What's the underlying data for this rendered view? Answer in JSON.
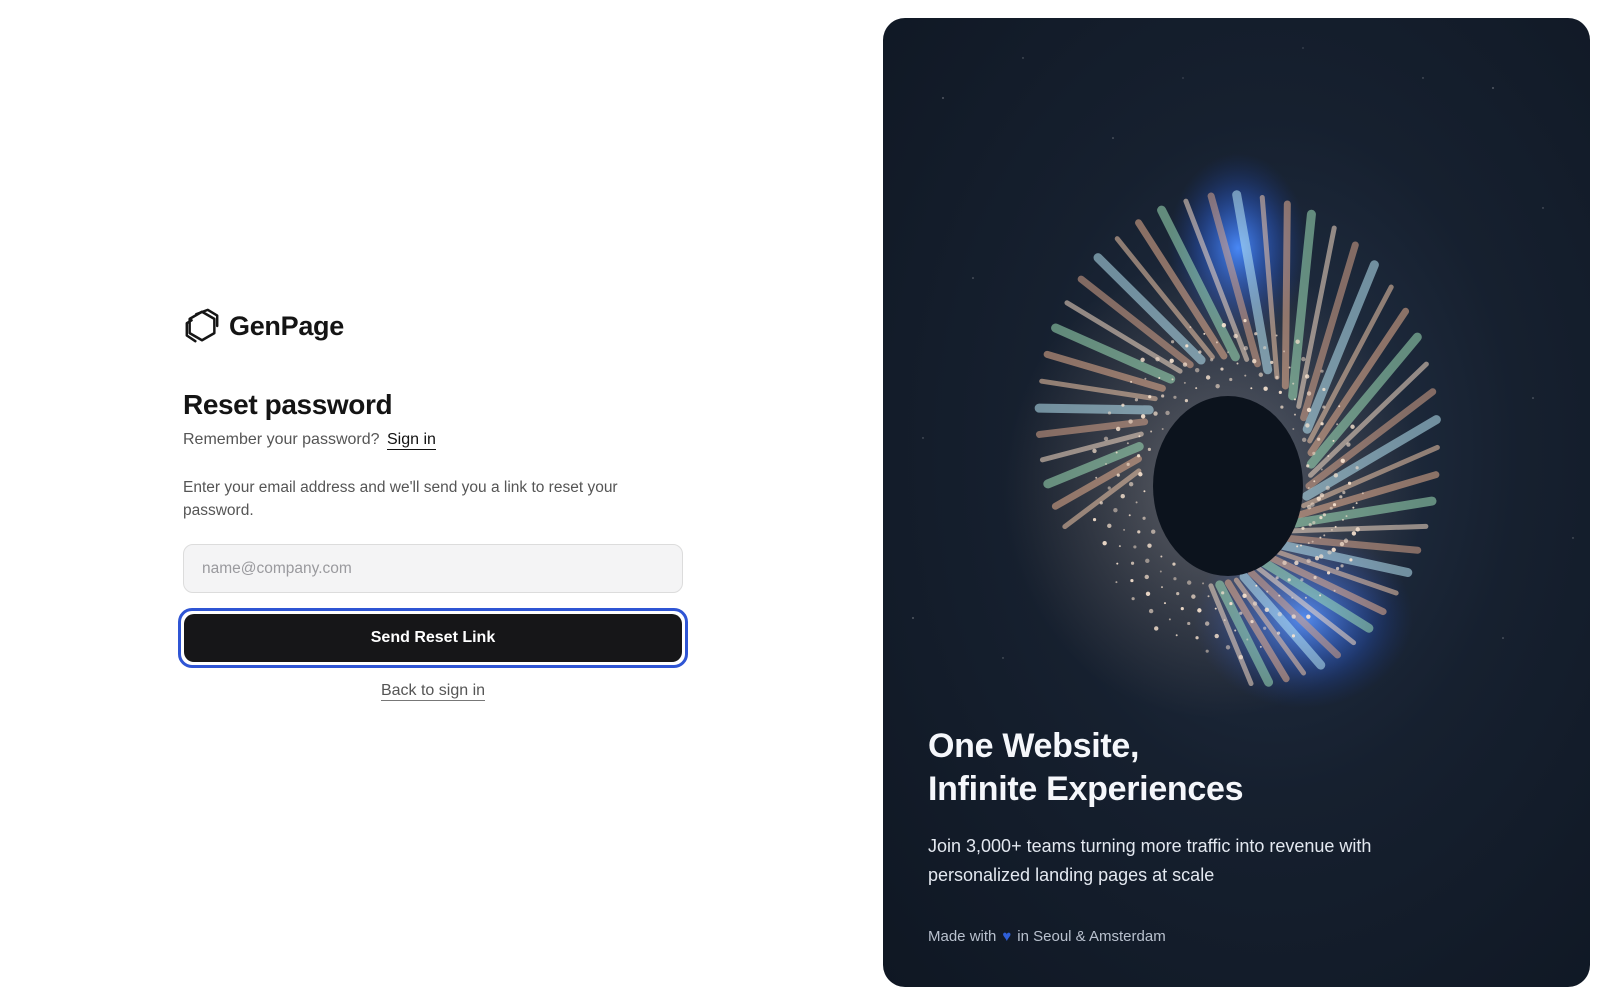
{
  "brand": {
    "name": "GenPage",
    "logo_icon": "genpage-logo-icon"
  },
  "form": {
    "title": "Reset password",
    "subtitle_prefix": "Remember your password?",
    "signin_link": "Sign in",
    "instructions": "Enter your email address and we'll send you a link to reset your password.",
    "email_placeholder": "name@company.com",
    "email_value": "",
    "submit_label": "Send Reset Link",
    "back_link": "Back to sign in"
  },
  "hero": {
    "title_line1": "One Website,",
    "title_line2": "Infinite Experiences",
    "body": "Join 3,000+ teams turning more traffic into revenue with personalized landing pages at scale",
    "footer_prefix": "Made with",
    "footer_icon": "heart-icon",
    "footer_suffix": "in Seoul & Amsterdam"
  },
  "colors": {
    "primary_button": "#161618",
    "focus_ring": "#2f55d4",
    "hero_bg": "#16202f",
    "heart": "#2f5fd8"
  }
}
